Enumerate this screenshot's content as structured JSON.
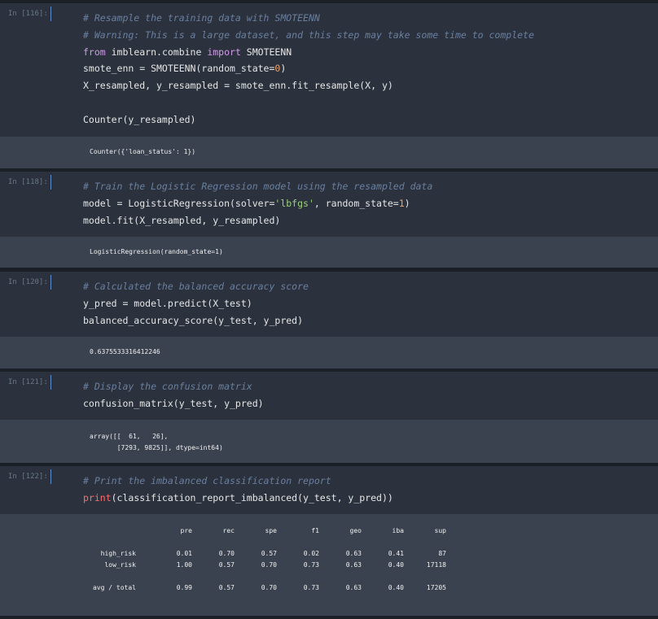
{
  "cells": [
    {
      "prompt": "In [116]:",
      "lines": [
        [
          {
            "t": "# Resample the training data with SMOTEENN",
            "c": "cm"
          }
        ],
        [
          {
            "t": "# Warning: This is a large dataset, and this step may take some time to complete",
            "c": "cm"
          }
        ],
        [
          {
            "t": "from",
            "c": "kw"
          },
          {
            "t": " imblearn.combine ",
            "c": ""
          },
          {
            "t": "import",
            "c": "kw"
          },
          {
            "t": " SMOTEENN",
            "c": ""
          }
        ],
        [
          {
            "t": "smote_enn = SMOTEENN(random_state=",
            "c": ""
          },
          {
            "t": "0",
            "c": "num"
          },
          {
            "t": ")",
            "c": ""
          }
        ],
        [
          {
            "t": "X_resampled, y_resampled = smote_enn.fit_resample(X, y)",
            "c": ""
          }
        ],
        [
          {
            "t": "",
            "c": ""
          }
        ],
        [
          {
            "t": "Counter(y_resampled)",
            "c": ""
          }
        ]
      ],
      "output": "Counter({'loan_status': 1})"
    },
    {
      "prompt": "In [118]:",
      "lines": [
        [
          {
            "t": "# Train the Logistic Regression model using the resampled data",
            "c": "cm"
          }
        ],
        [
          {
            "t": "model = LogisticRegression(solver=",
            "c": ""
          },
          {
            "t": "'lbfgs'",
            "c": "str"
          },
          {
            "t": ", random_state=",
            "c": ""
          },
          {
            "t": "1",
            "c": "num"
          },
          {
            "t": ")",
            "c": ""
          }
        ],
        [
          {
            "t": "model.fit(X_resampled, y_resampled)",
            "c": ""
          }
        ]
      ],
      "output": "LogisticRegression(random_state=1)"
    },
    {
      "prompt": "In [120]:",
      "lines": [
        [
          {
            "t": "# Calculated the balanced accuracy score",
            "c": "cm"
          }
        ],
        [
          {
            "t": "y_pred = model.predict(X_test)",
            "c": ""
          }
        ],
        [
          {
            "t": "balanced_accuracy_score(y_test, y_pred)",
            "c": ""
          }
        ]
      ],
      "output": "0.6375533316412246"
    },
    {
      "prompt": "In [121]:",
      "lines": [
        [
          {
            "t": "# Display the confusion matrix",
            "c": "cm"
          }
        ],
        [
          {
            "t": "confusion_matrix(y_test, y_pred)",
            "c": ""
          }
        ]
      ],
      "output": "array([[  61,   26],\n       [7293, 9825]], dtype=int64)"
    },
    {
      "prompt": "In [122]:",
      "lines": [
        [
          {
            "t": "# Print the imbalanced classification report",
            "c": "cm"
          }
        ],
        [
          {
            "t": "print",
            "c": "fn"
          },
          {
            "t": "(classification_report_imbalanced(y_test, y_pred))",
            "c": ""
          }
        ]
      ],
      "output": ""
    }
  ],
  "report": {
    "headers": [
      "pre",
      "rec",
      "spe",
      "f1",
      "geo",
      "iba",
      "sup"
    ],
    "rows": [
      {
        "label": "high_risk",
        "values": [
          "0.01",
          "0.70",
          "0.57",
          "0.02",
          "0.63",
          "0.41",
          "87"
        ]
      },
      {
        "label": "low_risk",
        "values": [
          "1.00",
          "0.57",
          "0.70",
          "0.73",
          "0.63",
          "0.40",
          "17118"
        ]
      },
      {
        "label": "avg / total",
        "values": [
          "0.99",
          "0.57",
          "0.70",
          "0.73",
          "0.63",
          "0.40",
          "17205"
        ]
      }
    ]
  }
}
